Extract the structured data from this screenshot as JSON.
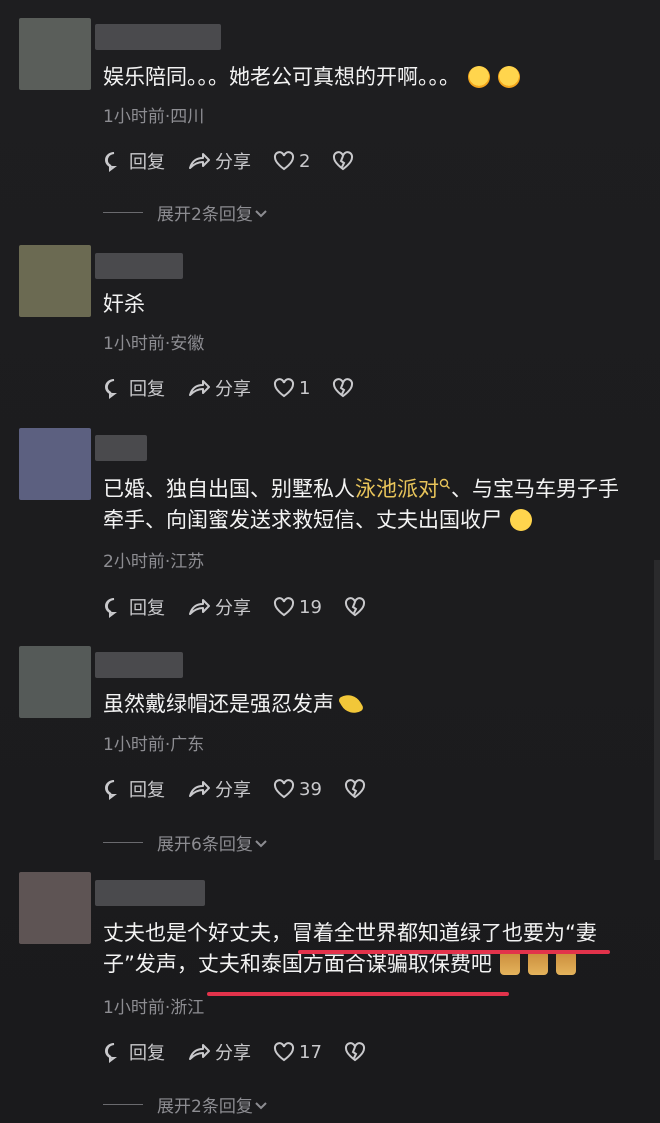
{
  "comments": [
    {
      "text_parts": [
        "娱乐陪同。。。她老公可真想的开啊。。。"
      ],
      "emojis": [
        "hug-emoji",
        "hug-emoji"
      ],
      "meta": "1小时前·四川",
      "reply_label": "回复",
      "share_label": "分享",
      "likes": "2",
      "expand": "展开2条回复"
    },
    {
      "text_parts": [
        "奸杀"
      ],
      "meta": "1小时前·安徽",
      "reply_label": "回复",
      "share_label": "分享",
      "likes": "1"
    },
    {
      "text_line1_a": "已婚、独自出国、别墅私人",
      "text_highlight": "泳池派对",
      "text_line1_b": "、与宝马车男子手",
      "text_line2": "牵手、向闺蜜发送求救短信、丈夫出国收尸",
      "meta": "2小时前·江苏",
      "reply_label": "回复",
      "share_label": "分享",
      "likes": "19"
    },
    {
      "text_parts": [
        "虽然戴绿帽还是强忍发声"
      ],
      "meta": "1小时前·广东",
      "reply_label": "回复",
      "share_label": "分享",
      "likes": "39",
      "expand": "展开6条回复"
    },
    {
      "text_line1": "丈夫也是个好丈夫，冒着全世界都知道绿了也要为“妻",
      "text_line2": "子”发声，丈夫和泰国方面合谋骗取保费吧",
      "meta": "1小时前·浙江",
      "reply_label": "回复",
      "share_label": "分享",
      "likes": "17",
      "expand": "展开2条回复"
    }
  ],
  "colors": {
    "background": "#1c1c1e",
    "highlight": "#e8c45a",
    "underline": "#e2334b",
    "meta": "#8d8d92"
  },
  "icons": [
    "reply-bubble-icon",
    "share-arrow-icon",
    "like-heart-icon",
    "dislike-broken-heart-icon",
    "chevron-down-icon",
    "search-icon"
  ]
}
